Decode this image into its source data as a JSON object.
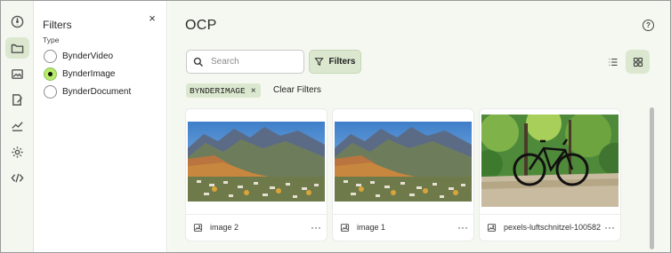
{
  "rail": {
    "items": [
      {
        "icon": "dashboard-icon"
      },
      {
        "icon": "folder-icon",
        "active": true
      },
      {
        "icon": "image-gallery-icon"
      },
      {
        "icon": "edit-document-icon"
      },
      {
        "icon": "analytics-icon"
      },
      {
        "icon": "settings-icon"
      },
      {
        "icon": "code-icon"
      }
    ]
  },
  "filters": {
    "title": "Filters",
    "close_label": "×",
    "type_label": "Type",
    "options": [
      {
        "label": "BynderVideo",
        "selected": false
      },
      {
        "label": "BynderImage",
        "selected": true
      },
      {
        "label": "BynderDocument",
        "selected": false
      }
    ]
  },
  "main": {
    "title": "OCP",
    "help_label": "?",
    "search": {
      "placeholder": "Search",
      "value": ""
    },
    "filters_button": "Filters",
    "active_chip": "BYNDERIMAGE",
    "chip_remove": "×",
    "clear_filters": "Clear Filters",
    "view_mode": "grid",
    "cards": [
      {
        "name": "image 2",
        "thumbnail": "mountain-town-landscape"
      },
      {
        "name": "image 1",
        "thumbnail": "mountain-town-landscape"
      },
      {
        "name": "pexels-luftschnitzel-100582",
        "thumbnail": "bicycle-forest-path"
      }
    ],
    "more_label": "···"
  },
  "colors": {
    "accent_bg": "#dbe8cf",
    "radio_selected": "#b6ec6a",
    "main_bg": "#f5f8f0"
  }
}
